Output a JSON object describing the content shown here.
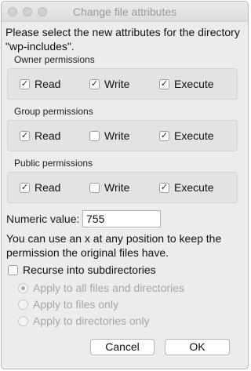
{
  "window": {
    "title": "Change file attributes"
  },
  "intro": {
    "text": "Please select the new attributes for the directory \"wp-includes\"."
  },
  "groups": [
    {
      "label": "Owner permissions",
      "options": [
        {
          "label": "Read",
          "checked": true
        },
        {
          "label": "Write",
          "checked": true
        },
        {
          "label": "Execute",
          "checked": true
        }
      ]
    },
    {
      "label": "Group permissions",
      "options": [
        {
          "label": "Read",
          "checked": true
        },
        {
          "label": "Write",
          "checked": false
        },
        {
          "label": "Execute",
          "checked": true
        }
      ]
    },
    {
      "label": "Public permissions",
      "options": [
        {
          "label": "Read",
          "checked": true
        },
        {
          "label": "Write",
          "checked": false
        },
        {
          "label": "Execute",
          "checked": true
        }
      ]
    }
  ],
  "numeric": {
    "label": "Numeric value:",
    "value": "755"
  },
  "hint": {
    "text": "You can use an x at any position to keep the permission the original files have."
  },
  "recurse": {
    "label": "Recurse into subdirectories",
    "checked": false
  },
  "scope": {
    "options": [
      {
        "label": "Apply to all files and directories",
        "selected": true
      },
      {
        "label": "Apply to files only",
        "selected": false
      },
      {
        "label": "Apply to directories only",
        "selected": false
      }
    ]
  },
  "buttons": {
    "cancel": "Cancel",
    "ok": "OK"
  },
  "icons": {
    "check": "checkmark-icon"
  }
}
